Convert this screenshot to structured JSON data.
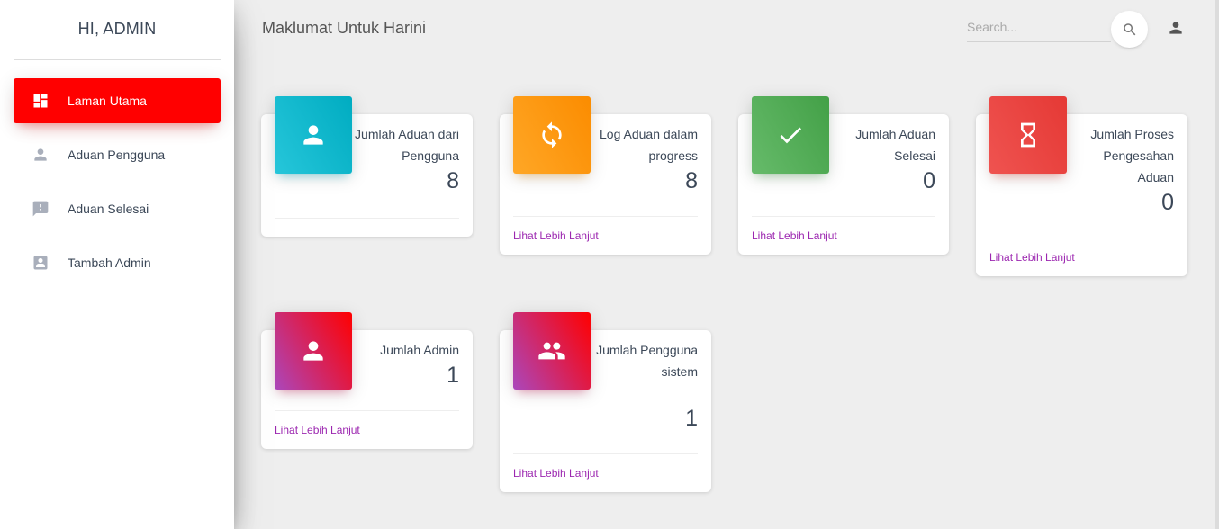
{
  "sidebar": {
    "brand": "HI, ADMIN",
    "items": [
      {
        "label": "Laman Utama",
        "icon": "dashboard-icon",
        "active": true
      },
      {
        "label": "Aduan Pengguna",
        "icon": "person-icon"
      },
      {
        "label": "Aduan Selesai",
        "icon": "feedback-icon"
      },
      {
        "label": "Tambah Admin",
        "icon": "account-box-icon"
      }
    ]
  },
  "header": {
    "title": "Maklumat Untuk Harini",
    "search_placeholder": "Search...",
    "search_icon": "search-icon",
    "user_icon": "person-icon"
  },
  "cards": [
    {
      "category": "Jumlah Aduan dari Pengguna",
      "value": "8",
      "link": "",
      "icon": "person-icon",
      "color": "#00acc1"
    },
    {
      "category": "Log Aduan dalam progress",
      "value": "8",
      "link": "Lihat Lebih Lanjut",
      "icon": "sync-icon",
      "color": "#fb8c00"
    },
    {
      "category": "Jumlah Aduan Selesai",
      "value": "0",
      "link": "Lihat Lebih Lanjut",
      "icon": "check-icon",
      "color": "#43a047"
    },
    {
      "category": "Jumlah Proses Pengesahan Aduan",
      "value": "0",
      "link": "Lihat Lebih Lanjut",
      "icon": "hourglass-icon",
      "color": "#e53935"
    },
    {
      "category": "Jumlah Admin",
      "value": "1",
      "link": "Lihat Lebih Lanjut",
      "icon": "person-icon",
      "color": "#ff0000"
    },
    {
      "category": "Jumlah Pengguna sistem",
      "value": "1",
      "link": "Lihat Lebih Lanjut",
      "icon": "people-icon",
      "color": "#ff0000"
    }
  ],
  "colors": {
    "accent": "#ff0000",
    "link": "#9c27b0",
    "background": "#eeeeee"
  }
}
